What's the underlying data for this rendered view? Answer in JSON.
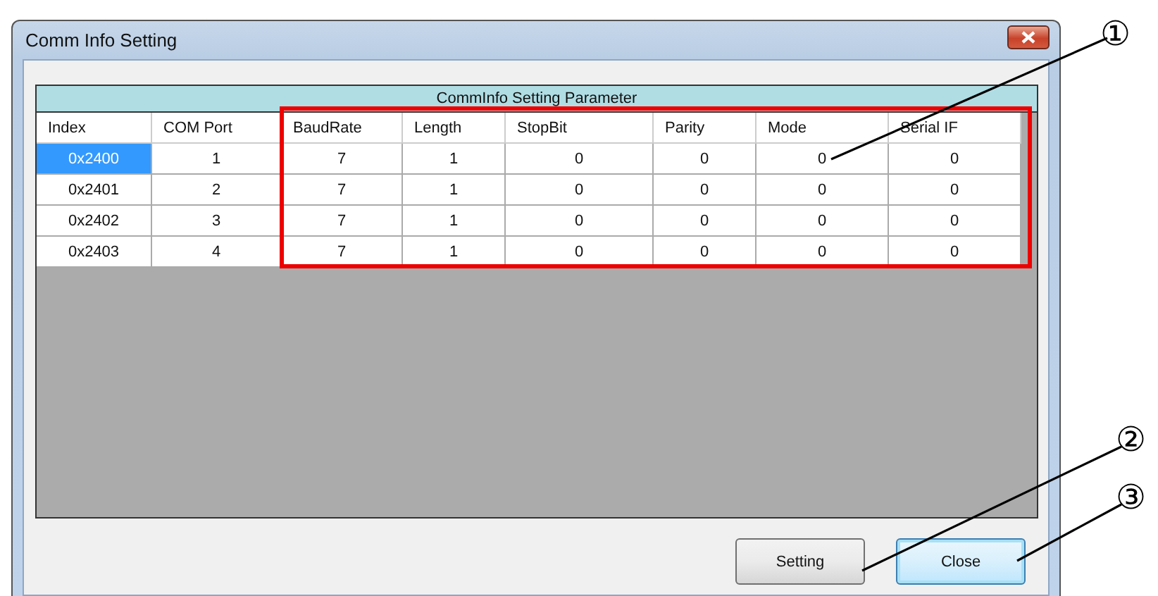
{
  "window": {
    "title": "Comm Info Setting"
  },
  "table": {
    "caption": "CommInfo Setting Parameter",
    "columns": [
      "Index",
      "COM Port",
      "BaudRate",
      "Length",
      "StopBit",
      "Parity",
      "Mode",
      "Serial IF"
    ],
    "rows": [
      {
        "selected": true,
        "cells": [
          "0x2400",
          "1",
          "7",
          "1",
          "0",
          "0",
          "0",
          "0"
        ]
      },
      {
        "selected": false,
        "cells": [
          "0x2401",
          "2",
          "7",
          "1",
          "0",
          "0",
          "0",
          "0"
        ]
      },
      {
        "selected": false,
        "cells": [
          "0x2402",
          "3",
          "7",
          "1",
          "0",
          "0",
          "0",
          "0"
        ]
      },
      {
        "selected": false,
        "cells": [
          "0x2403",
          "4",
          "7",
          "1",
          "0",
          "0",
          "0",
          "0"
        ]
      }
    ]
  },
  "buttons": [
    {
      "label": "Setting",
      "focused": false
    },
    {
      "label": "Close",
      "focused": true
    }
  ],
  "callouts": [
    "①",
    "②",
    "③"
  ]
}
